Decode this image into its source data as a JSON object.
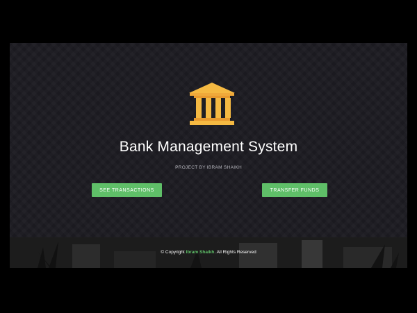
{
  "hero": {
    "logo_icon": "bank-building-icon",
    "title": "Bank Management System",
    "subtitle": "PROJECT BY IBRAM SHAIKH"
  },
  "actions": {
    "see_transactions": "SEE TRANSACTIONS",
    "transfer_funds": "TRANSFER FUNDS"
  },
  "footer": {
    "prefix": "© Copyright ",
    "author": "Ibram Shaikh",
    "suffix": ". All Rights Reserved"
  },
  "colors": {
    "background": "#1f1e24",
    "accent": "#5fbf68",
    "logo": "#f5b942"
  }
}
